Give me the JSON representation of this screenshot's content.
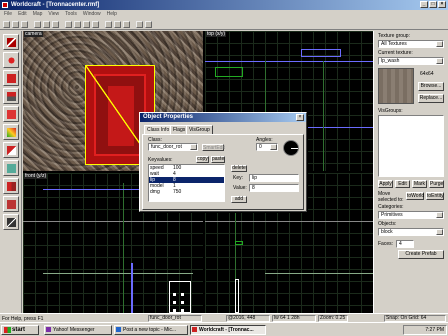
{
  "app": {
    "title": "Worldcraft - [Tronnacenter.rmf]"
  },
  "menu": [
    "File",
    "Edit",
    "Map",
    "View",
    "Tools",
    "Window",
    "Help"
  ],
  "viewports": {
    "camera": "camera",
    "top": "top (x/y)",
    "front": "front (y/z)"
  },
  "right_panel": {
    "texture_group_label": "Texture group:",
    "texture_group_value": "All Textures",
    "current_texture_label": "Current texture:",
    "current_texture_value": "lp_wash",
    "texture_size": "64x64",
    "browse_label": "Browse...",
    "replace_label": "Replace...",
    "visgroups_label": "VisGroups:",
    "apply_label": "Apply",
    "edit_label": "Edit",
    "mark_label": "Mark",
    "purge_label": "Purge",
    "move_selected_label": "Move selected to:",
    "to_world_label": "toWorld",
    "to_entity_label": "toEntity",
    "categories_label": "Categories:",
    "categories_value": "Primitives",
    "objects_label": "Objects:",
    "objects_value": "block",
    "faces_label": "Faces:",
    "faces_value": "4",
    "create_prefab_label": "Create Prefab"
  },
  "dialog": {
    "title": "Object Properties",
    "tabs": [
      "Class Info",
      "Flags",
      "VisGroup"
    ],
    "class_label": "Class:",
    "class_value": "func_door_rot",
    "smartedit_label": "SmartEdit",
    "angles_label": "Angles:",
    "angles_value": "0",
    "keyvalues_label": "Keyvalues:",
    "copy_label": "copy",
    "paste_label": "paste",
    "keyvalues": [
      {
        "key": "speed",
        "value": "100"
      },
      {
        "key": "wait",
        "value": "4"
      },
      {
        "key": "lip",
        "value": "8"
      },
      {
        "key": "model",
        "value": "1"
      },
      {
        "key": "dmg",
        "value": "750"
      }
    ],
    "delete_label": "delete",
    "key_label": "Key:",
    "key_value": "lip",
    "value_label": "Value:",
    "value_value": "8",
    "add_label": "add"
  },
  "status": {
    "help": "For Help, press F1",
    "entity": "func_door_rot",
    "coords": "@2016, 448",
    "size": "lw 64 1 28h",
    "zoom": "Zoom: 0.25",
    "snap": "Snap: On Grid: 64"
  },
  "taskbar": {
    "start_label": "start",
    "tasks": [
      {
        "label": "Yahoo! Messenger",
        "color": "#7b2fa8"
      },
      {
        "label": "Post a new topic - Mic...",
        "color": "#2266cc"
      },
      {
        "label": "Worldcraft - [Tronnac...",
        "color": "#cc2222"
      }
    ],
    "clock": "7:27 PM"
  }
}
